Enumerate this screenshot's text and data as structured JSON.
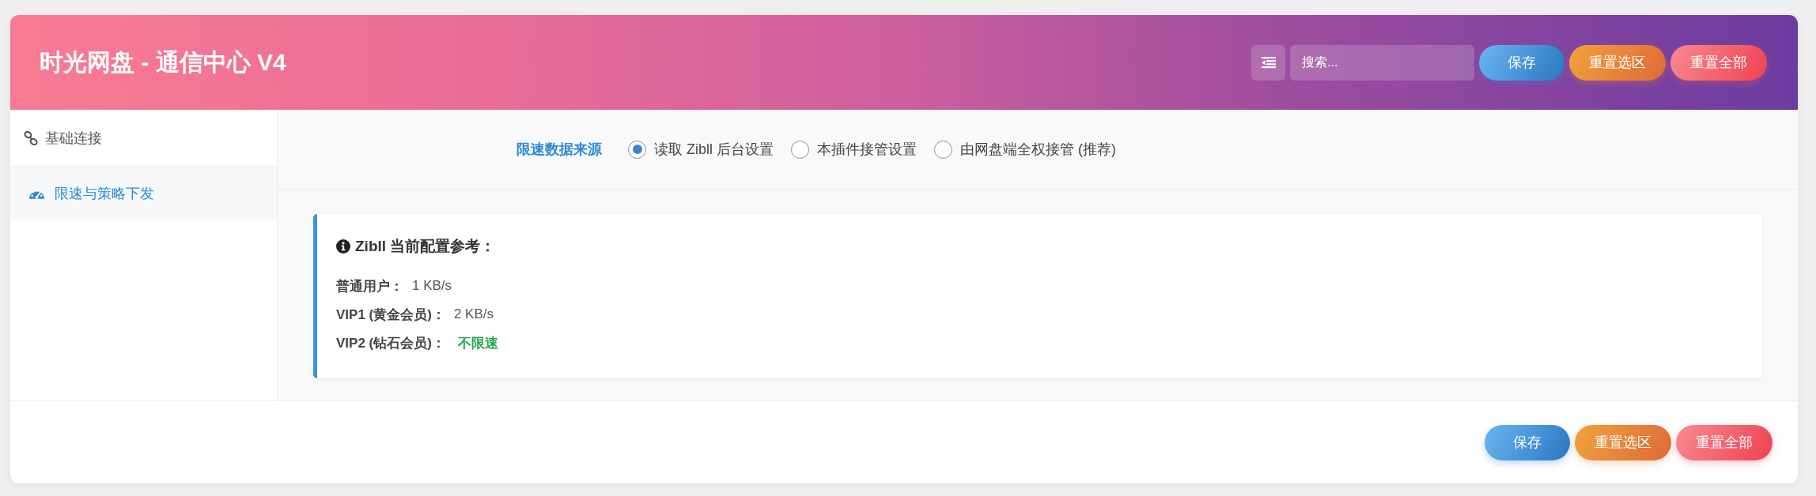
{
  "window": {
    "title": "时光网盘 - 通信中心 V4"
  },
  "toolbar": {
    "search": {
      "placeholder": "搜索..."
    },
    "buttons": [
      {
        "label": "保存",
        "kind": "save"
      },
      {
        "label": "重置选区",
        "kind": "reset_section"
      },
      {
        "label": "重置全部",
        "kind": "reset_all"
      }
    ]
  },
  "sidebar": {
    "items": [
      {
        "label": "基础连接",
        "selected": false
      },
      {
        "label": "限速与策略下发",
        "selected": true
      }
    ]
  },
  "form": {
    "fields": [
      {
        "label": "限速数据来源",
        "options": [
          {
            "label": "读取 Zibll 后台设置",
            "selected": true
          },
          {
            "label": "本插件接管设置",
            "selected": false
          },
          {
            "label": "由网盘端全权接管 (推荐)",
            "selected": false
          }
        ]
      }
    ]
  },
  "info_card": {
    "title": "Zibll 当前配置参考：",
    "rows": [
      {
        "label": "普通用户：",
        "value": "1 KB/s",
        "emphasized": false
      },
      {
        "label": "VIP1 (黄金会员)：",
        "value": "2 KB/s",
        "emphasized": false
      },
      {
        "label": "VIP2 (钻石会员)：",
        "value": "不限速",
        "emphasized": true
      }
    ]
  },
  "footer": {
    "buttons": [
      {
        "label": "保存",
        "kind": "save"
      },
      {
        "label": "重置选区",
        "kind": "reset_section"
      },
      {
        "label": "重置全部",
        "kind": "reset_all"
      }
    ]
  }
}
